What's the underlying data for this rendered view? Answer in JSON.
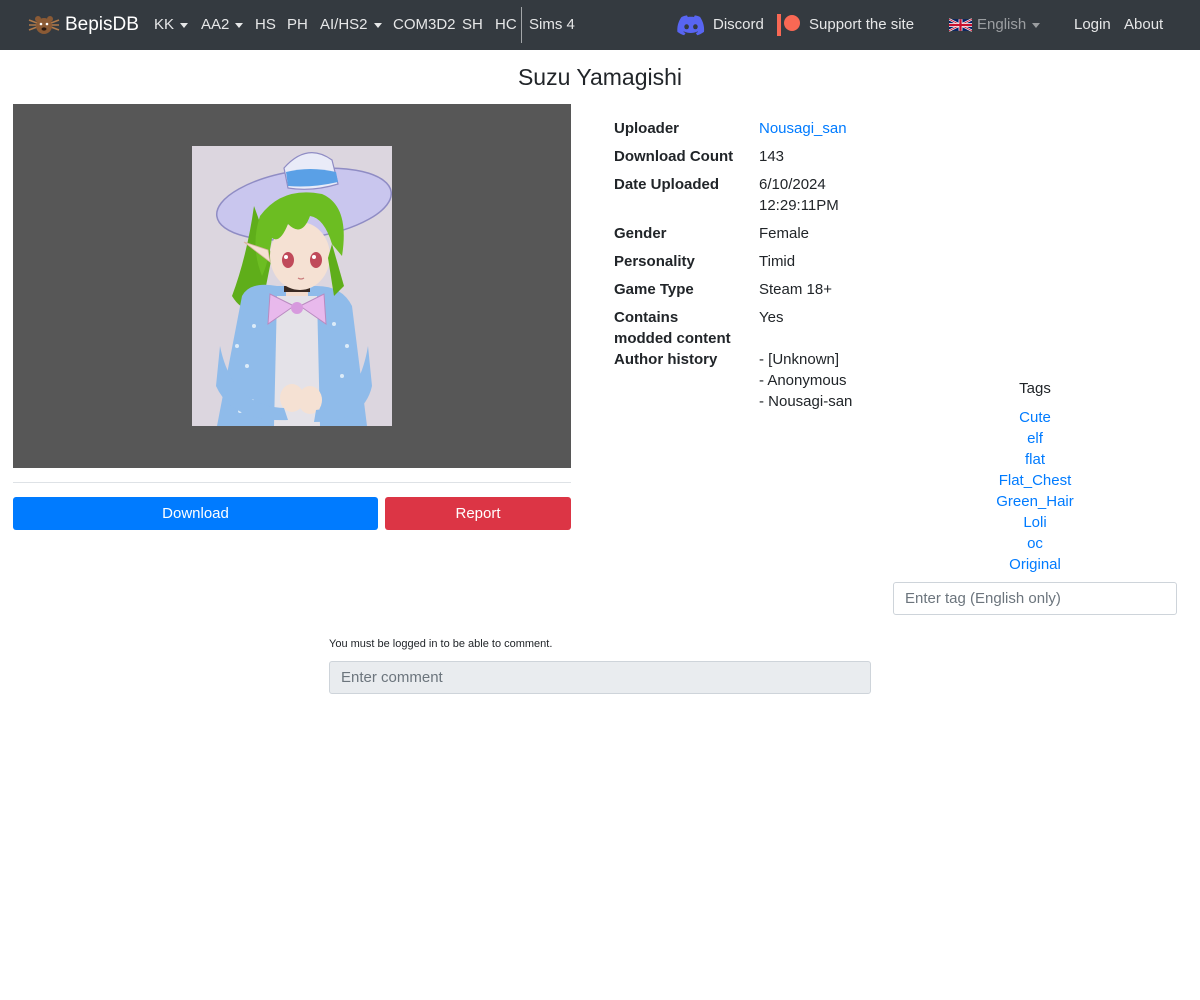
{
  "nav": {
    "brand": "BepisDB",
    "items": [
      {
        "label": "KK",
        "dropdown": true
      },
      {
        "label": "AA2",
        "dropdown": true
      },
      {
        "label": "HS",
        "dropdown": false
      },
      {
        "label": "PH",
        "dropdown": false
      },
      {
        "label": "AI/HS2",
        "dropdown": true
      },
      {
        "label": "COM3D2",
        "dropdown": false
      },
      {
        "label": "SH",
        "dropdown": false
      },
      {
        "label": "HC",
        "dropdown": false
      },
      {
        "label": "Sims 4",
        "dropdown": false
      }
    ],
    "discord": "Discord",
    "support": "Support the site",
    "language": "English",
    "login": "Login",
    "about": "About"
  },
  "card": {
    "title": "Suzu Yamagishi",
    "details": [
      {
        "label": "Uploader",
        "value": [
          "Nousagi_san"
        ],
        "link": true
      },
      {
        "label": "Download Count",
        "value": [
          "143"
        ]
      },
      {
        "label": "Date Uploaded",
        "value": [
          "6/10/2024",
          "12:29:11PM"
        ]
      },
      {
        "label": "Gender",
        "value": [
          "Female"
        ]
      },
      {
        "label": "Personality",
        "value": [
          "Timid"
        ]
      },
      {
        "label": "Game Type",
        "value": [
          "Steam 18+"
        ]
      },
      {
        "label": "Contains modded content",
        "value": [
          "Yes"
        ]
      },
      {
        "label": "Author history",
        "value": [
          "- [Unknown]",
          "- Anonymous",
          "- Nousagi-san"
        ]
      }
    ]
  },
  "actions": {
    "download": "Download",
    "report": "Report"
  },
  "tags": {
    "title": "Tags",
    "items": [
      "Cute",
      "elf",
      "flat",
      "Flat_Chest",
      "Green_Hair",
      "Loli",
      "oc",
      "Original"
    ],
    "placeholder": "Enter tag (English only)"
  },
  "comments": {
    "notice": "You must be logged in to be able to comment.",
    "placeholder": "Enter comment"
  },
  "colors": {
    "navbar": "#343a40",
    "primary": "#007bff",
    "danger": "#dc3545",
    "preview_bg": "#575757"
  }
}
